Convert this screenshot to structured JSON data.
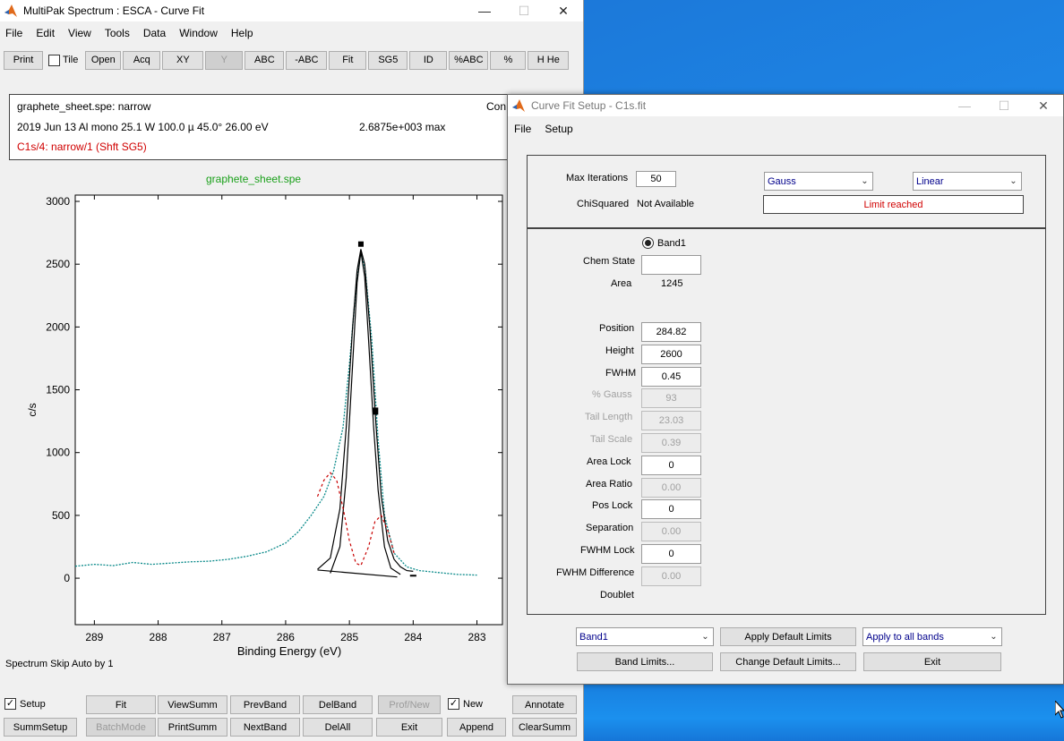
{
  "main": {
    "title": "MultiPak Spectrum : ESCA - Curve Fit",
    "menu": [
      "File",
      "Edit",
      "View",
      "Tools",
      "Data",
      "Window",
      "Help"
    ],
    "toolbar": {
      "print": "Print",
      "tile": "Tile",
      "open": "Open",
      "acq": "Acq",
      "xy": "XY",
      "y": "Y",
      "abc": "ABC",
      "minus_abc": "-ABC",
      "fit": "Fit",
      "sg5": "SG5",
      "id": "ID",
      "pct_abc": "%ABC",
      "pct": "%",
      "hhe": "H He"
    },
    "info": {
      "line1": "graphete_sheet.spe: narrow",
      "line1_right": "Con",
      "line2": "2019 Jun 13  Al mono  25.1 W  100.0 µ  45.0°  26.00 eV",
      "line2_right": "2.6875e+003 max",
      "line3": "C1s/4: narrow/1 (Shft SG5)"
    },
    "status": "Spectrum Skip Auto by 1",
    "bottom": {
      "setup": "Setup",
      "fit": "Fit",
      "viewsumm": "ViewSumm",
      "prevband": "PrevBand",
      "delband": "DelBand",
      "profnew": "Prof/New",
      "new": "New",
      "annotate": "Annotate",
      "summsetup": "SummSetup",
      "batchmode": "BatchMode",
      "printsumm": "PrintSumm",
      "nextband": "NextBand",
      "delall": "DelAll",
      "exit": "Exit",
      "append": "Append",
      "clearsumm": "ClearSumm"
    }
  },
  "chart_data": {
    "type": "line",
    "title": "graphete_sheet.spe",
    "xlabel": "Binding Energy (eV)",
    "ylabel": "c/s",
    "xlim": [
      289.3,
      282.6
    ],
    "ylim": [
      -370,
      3050
    ],
    "x_reversed": true,
    "xticks": [
      289,
      288,
      287,
      286,
      285,
      284,
      283
    ],
    "yticks": [
      0,
      500,
      1000,
      1500,
      2000,
      2500,
      3000
    ],
    "series": [
      {
        "style": "data-teal-dotted",
        "color": "#0a8a8a",
        "x": [
          289.3,
          289.0,
          288.7,
          288.4,
          288.1,
          287.8,
          287.5,
          287.2,
          286.9,
          286.6,
          286.3,
          286.0,
          285.8,
          285.6,
          285.4,
          285.25,
          285.1,
          285.0,
          284.9,
          284.82,
          284.75,
          284.65,
          284.55,
          284.45,
          284.3,
          284.1,
          283.9,
          283.6,
          283.3,
          283.0
        ],
        "y": [
          95,
          110,
          100,
          125,
          110,
          120,
          130,
          135,
          150,
          175,
          210,
          280,
          370,
          500,
          650,
          850,
          1200,
          1700,
          2300,
          2600,
          2450,
          1900,
          1100,
          500,
          200,
          90,
          60,
          45,
          30,
          25
        ]
      },
      {
        "style": "fit-envelope",
        "color": "#000000",
        "x": [
          285.5,
          285.3,
          285.15,
          285.05,
          284.95,
          284.88,
          284.82,
          284.76,
          284.68,
          284.58,
          284.5,
          284.4,
          284.3,
          284.2,
          284.1,
          284.0
        ],
        "y": [
          70,
          160,
          550,
          1200,
          2000,
          2450,
          2620,
          2500,
          2000,
          1200,
          650,
          300,
          150,
          90,
          60,
          55
        ]
      },
      {
        "style": "band1-peak",
        "color": "#000000",
        "x": [
          285.3,
          285.15,
          285.05,
          284.95,
          284.88,
          284.82,
          284.76,
          284.7,
          284.62,
          284.55,
          284.45,
          284.35,
          284.2
        ],
        "y": [
          40,
          250,
          800,
          1700,
          2350,
          2600,
          2400,
          1900,
          1200,
          700,
          250,
          80,
          30
        ]
      },
      {
        "style": "residual-red-dashed",
        "color": "#c80000",
        "x": [
          285.5,
          285.4,
          285.3,
          285.2,
          285.1,
          285.0,
          284.9,
          284.82,
          284.7,
          284.6,
          284.5,
          284.4,
          284.3
        ],
        "y": [
          650,
          780,
          840,
          780,
          560,
          300,
          120,
          100,
          250,
          450,
          500,
          380,
          200
        ]
      }
    ]
  },
  "dialog": {
    "title": "Curve Fit Setup - C1s.fit",
    "menu": [
      "File",
      "Setup"
    ],
    "max_iterations_label": "Max Iterations",
    "max_iterations": "50",
    "chisquared_label": "ChiSquared",
    "chisquared_value": "Not Available",
    "shape_select": "Gauss",
    "background_select": "Linear",
    "limit_message": "Limit reached",
    "band_radio": "Band1",
    "chem_state_label": "Chem State",
    "chem_state": "",
    "area_label": "Area",
    "area_value": "1245",
    "position_label": "Position",
    "position": "284.82",
    "height_label": "Height",
    "height": "2600",
    "fwhm_label": "FWHM",
    "fwhm": "0.45",
    "gauss_label": "% Gauss",
    "gauss": "93",
    "tail_length_label": "Tail Length",
    "tail_length": "23.03",
    "tail_scale_label": "Tail Scale",
    "tail_scale": "0.39",
    "area_lock_label": "Area Lock",
    "area_lock": "0",
    "area_ratio_label": "Area Ratio",
    "area_ratio": "0.00",
    "pos_lock_label": "Pos Lock",
    "pos_lock": "0",
    "separation_label": "Separation",
    "separation": "0.00",
    "fwhm_lock_label": "FWHM Lock",
    "fwhm_lock": "0",
    "fwhm_diff_label": "FWHM Difference",
    "fwhm_diff": "0.00",
    "doublet_label": "Doublet",
    "band_select": "Band1",
    "apply_default_limits": "Apply Default Limits",
    "apply_scope_select": "Apply to all bands",
    "band_limits": "Band Limits...",
    "change_default_limits": "Change Default Limits...",
    "exit": "Exit"
  }
}
